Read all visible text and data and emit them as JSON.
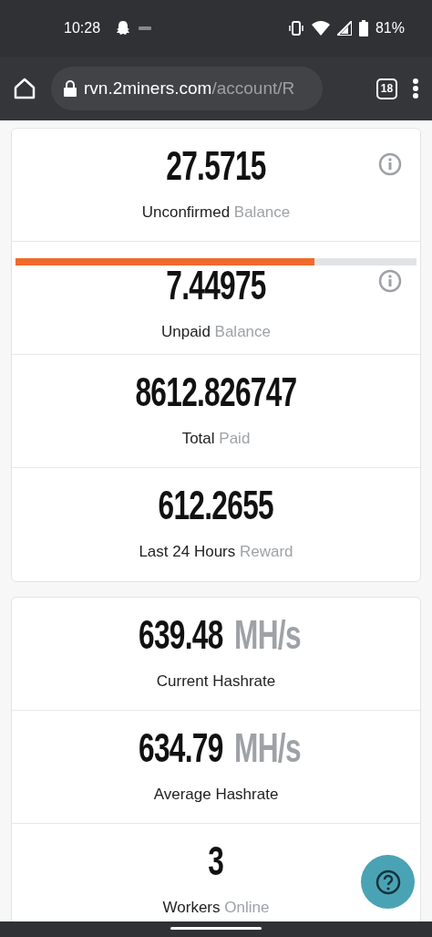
{
  "status_bar": {
    "time": "10:28",
    "battery": "81%"
  },
  "browser": {
    "url_host": "rvn.2miners.com",
    "url_path": "/account/R",
    "tab_count": "18"
  },
  "cards": [
    {
      "stats": [
        {
          "value": "27.5715",
          "label": "Unconfirmed",
          "label_muted": "Balance",
          "info": true
        },
        {
          "value": "7.44975",
          "label": "Unpaid",
          "label_muted": "Balance",
          "info": true,
          "level": 0.745
        },
        {
          "value": "8612.826747",
          "label": "Total",
          "label_muted": "Paid",
          "info": false
        },
        {
          "value": "612.2655",
          "label": "Last 24 Hours",
          "label_muted": "Reward",
          "info": false
        }
      ]
    },
    {
      "stats": [
        {
          "value": "639.48",
          "unit": "MH/s",
          "label": "Current Hashrate",
          "info": false
        },
        {
          "value": "634.79",
          "unit": "MH/s",
          "label": "Average Hashrate",
          "info": false
        },
        {
          "value": "3",
          "label": "Workers",
          "label_muted": "Online",
          "info": false
        }
      ]
    }
  ]
}
